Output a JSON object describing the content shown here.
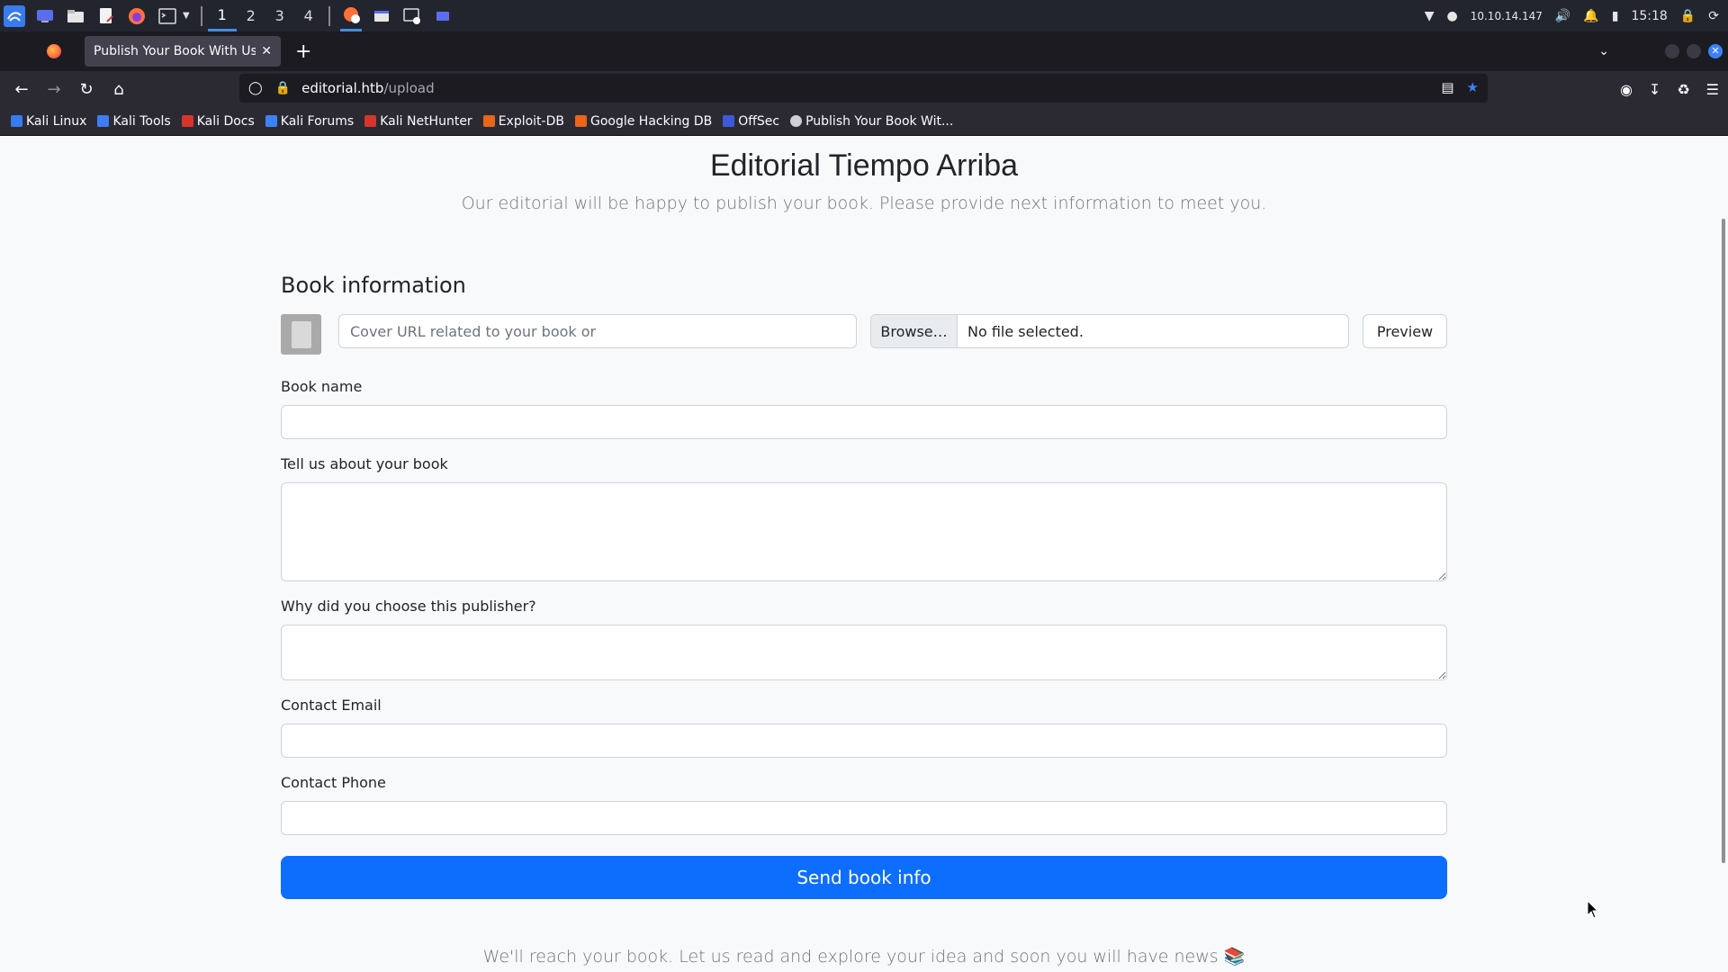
{
  "panel": {
    "workspaces": [
      "1",
      "2",
      "3",
      "4"
    ],
    "ip": "10.10.14.147",
    "clock": "15:18"
  },
  "browser": {
    "tab_title": "Publish Your Book With Us -",
    "url_host": "editorial.htb",
    "url_path": "/upload",
    "bookmarks": [
      {
        "label": "Kali Linux",
        "color": "#367bf0"
      },
      {
        "label": "Kali Tools",
        "color": "#3f7cf4"
      },
      {
        "label": "Kali Docs",
        "color": "#d9342b"
      },
      {
        "label": "Kali Forums",
        "color": "#3b82f6"
      },
      {
        "label": "Kali NetHunter",
        "color": "#d9342b"
      },
      {
        "label": "Exploit-DB",
        "color": "#e8651a"
      },
      {
        "label": "Google Hacking DB",
        "color": "#e8651a"
      },
      {
        "label": "OffSec",
        "color": "#3b5bdb"
      },
      {
        "label": "Publish Your Book Wit...",
        "color": "#cfcfd8"
      }
    ]
  },
  "page": {
    "title": "Editorial Tiempo Arriba",
    "lead": "Our editorial will be happy to publish your book. Please provide next information to meet you.",
    "section": "Book information",
    "cover_url_placeholder": "Cover URL related to your book or",
    "browse_label": "Browse…",
    "file_status": "No file selected.",
    "preview_label": "Preview",
    "book_name_label": "Book name",
    "about_label": "Tell us about your book",
    "why_label": "Why did you choose this publisher?",
    "email_label": "Contact Email",
    "phone_label": "Contact Phone",
    "submit_label": "Send book info",
    "footer_text": "We'll reach your book. Let us read and explore your idea and soon you will have news 📚"
  },
  "colors": {
    "primary": "#0d6efd",
    "panel_bg": "#23252e",
    "browser_bg": "#2b2a33"
  }
}
